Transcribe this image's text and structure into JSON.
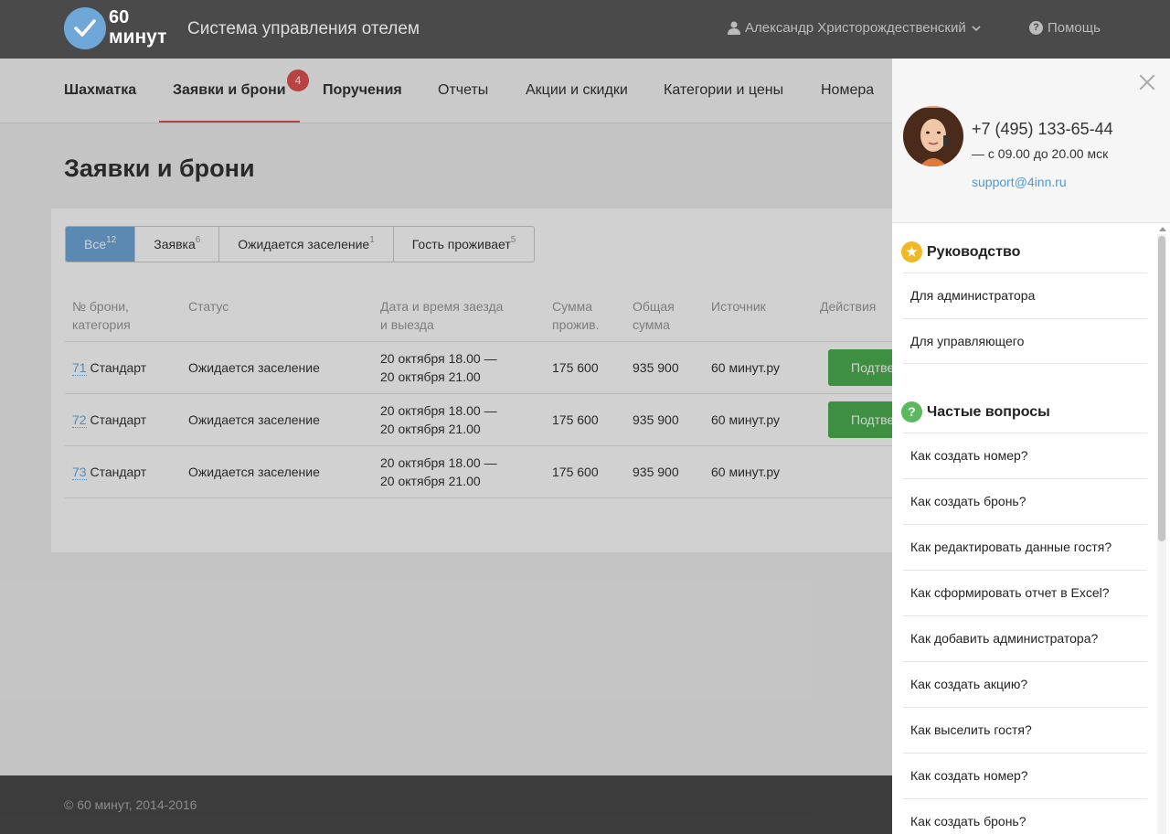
{
  "header": {
    "logo_line1": "60",
    "logo_line2": "минут",
    "app_title": "Система управления отелем",
    "user_name": "Александр Христорождественский",
    "help_label": "Помощь"
  },
  "nav": {
    "items": [
      "Шахматка",
      "Заявки и брони",
      "Поручения",
      "Отчеты",
      "Акции и скидки",
      "Категории и цены",
      "Номера"
    ],
    "badge": "4"
  },
  "page": {
    "title": "Заявки и брони"
  },
  "filters": [
    {
      "label": "Все",
      "count": "12"
    },
    {
      "label": "Заявка",
      "count": "6"
    },
    {
      "label": "Ожидается заселение",
      "count": "1"
    },
    {
      "label": "Гость проживает",
      "count": "5"
    }
  ],
  "table": {
    "headers": {
      "booking": "№ брони, категория",
      "status": "Статус",
      "dates": "Дата и время заезда и выезда",
      "stay_sum": "Сумма прожив.",
      "total": "Общая сумма",
      "source": "Источник",
      "actions": "Действия"
    },
    "rows": [
      {
        "num": "71",
        "category": "Стандарт",
        "status": "Ожидается заселение",
        "date_in": "20 октября 18.00 —",
        "date_out": "20 октября 21.00",
        "stay_sum": "175 600",
        "total": "935 900",
        "source": "60 минут.ру",
        "action": "Подтвердить"
      },
      {
        "num": "72",
        "category": "Стандарт",
        "status": "Ожидается заселение",
        "date_in": "20 октября 18.00 —",
        "date_out": "20 октября 21.00",
        "stay_sum": "175 600",
        "total": "935 900",
        "source": "60 минут.ру",
        "action": "Подтвердить"
      },
      {
        "num": "73",
        "category": "Стандарт",
        "status": "Ожидается заселение",
        "date_in": "20 октября 18.00 —",
        "date_out": "20 октября 21.00",
        "stay_sum": "175 600",
        "total": "935 900",
        "source": "60 минут.ру",
        "action": ""
      }
    ]
  },
  "footer": {
    "copyright": "© 60 минут, 2014-2016"
  },
  "panel": {
    "phone": "+7 (495) 133-65-44",
    "hours": "— с 09.00 до 20.00 мск",
    "email": "support@4inn.ru",
    "guide_title": "Руководство",
    "guide_items": [
      "Для администратора",
      "Для управляющего"
    ],
    "faq_title": "Частые вопросы",
    "faq_items": [
      "Как создать номер?",
      "Как создать бронь?",
      "Как редактировать данные гостя?",
      "Как сформировать отчет в Excel?",
      "Как добавить администратора?",
      "Как создать акцию?",
      "Как выселить гостя?",
      "Как создать номер?",
      "Как создать бронь?"
    ]
  },
  "colors": {
    "accent": "#6fa8d8",
    "badge": "#e05252",
    "confirm": "#4caf50",
    "header_bg": "#4a4a4a"
  }
}
